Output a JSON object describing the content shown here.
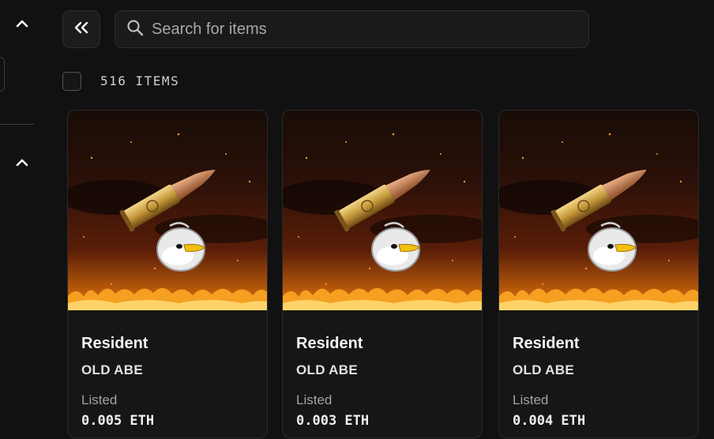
{
  "search": {
    "placeholder": "Search for items"
  },
  "listing": {
    "count_label": "516 ITEMS"
  },
  "items": [
    {
      "name": "Resident",
      "collection": "OLD ABE",
      "status": "Listed",
      "price": "0.005 ETH"
    },
    {
      "name": "Resident",
      "collection": "OLD ABE",
      "status": "Listed",
      "price": "0.003 ETH"
    },
    {
      "name": "Resident",
      "collection": "OLD ABE",
      "status": "Listed",
      "price": "0.004 ETH"
    }
  ],
  "icons": {
    "sidebar_toggle": "chevron-up-icon",
    "collapse": "double-chevron-left-icon",
    "search": "search-icon"
  },
  "colors": {
    "background": "#111111",
    "card": "#161616",
    "fire": "#f5a020"
  }
}
